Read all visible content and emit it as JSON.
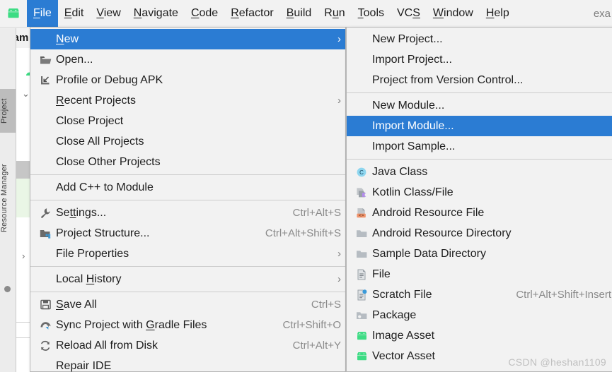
{
  "app": {
    "logo_icon": "android-logo-icon",
    "project_label_right": "exa",
    "breadcrumb_text": "exam"
  },
  "menubar": {
    "items": [
      {
        "label": "File",
        "mnemonic": "F",
        "active": true
      },
      {
        "label": "Edit",
        "mnemonic": "E",
        "active": false
      },
      {
        "label": "View",
        "mnemonic": "V",
        "active": false
      },
      {
        "label": "Navigate",
        "mnemonic": "N",
        "active": false
      },
      {
        "label": "Code",
        "mnemonic": "C",
        "active": false
      },
      {
        "label": "Refactor",
        "mnemonic": "R",
        "active": false
      },
      {
        "label": "Build",
        "mnemonic": "B",
        "active": false
      },
      {
        "label": "Run",
        "mnemonic": "u",
        "active": false
      },
      {
        "label": "Tools",
        "mnemonic": "T",
        "active": false
      },
      {
        "label": "VCS",
        "mnemonic": "S",
        "active": false
      },
      {
        "label": "Window",
        "mnemonic": "W",
        "active": false
      },
      {
        "label": "Help",
        "mnemonic": "H",
        "active": false
      }
    ]
  },
  "sidebar": {
    "tabs": [
      {
        "label": "Project",
        "selected": true
      },
      {
        "label": "Resource Manager",
        "selected": false
      }
    ]
  },
  "file_menu": {
    "items": [
      {
        "label": "New",
        "mnemonic": "N",
        "icon": "",
        "accel": "",
        "submenu": true,
        "selected": true,
        "separator_after": false
      },
      {
        "label": "Open...",
        "mnemonic": "",
        "icon": "folder-open-icon",
        "accel": "",
        "submenu": false,
        "selected": false,
        "separator_after": false
      },
      {
        "label": "Profile or Debug APK",
        "mnemonic": "",
        "icon": "apk-import-icon",
        "accel": "",
        "submenu": false,
        "selected": false,
        "separator_after": false
      },
      {
        "label": "Recent Projects",
        "mnemonic": "R",
        "icon": "",
        "accel": "",
        "submenu": true,
        "selected": false,
        "separator_after": false
      },
      {
        "label": "Close Project",
        "mnemonic": "",
        "icon": "",
        "accel": "",
        "submenu": false,
        "selected": false,
        "separator_after": false
      },
      {
        "label": "Close All Projects",
        "mnemonic": "",
        "icon": "",
        "accel": "",
        "submenu": false,
        "selected": false,
        "separator_after": false
      },
      {
        "label": "Close Other Projects",
        "mnemonic": "",
        "icon": "",
        "accel": "",
        "submenu": false,
        "selected": false,
        "separator_after": true
      },
      {
        "label": "Add C++ to Module",
        "mnemonic": "",
        "icon": "",
        "accel": "",
        "submenu": false,
        "selected": false,
        "separator_after": true
      },
      {
        "label": "Settings...",
        "mnemonic": "tt",
        "icon": "wrench-icon",
        "accel": "Ctrl+Alt+S",
        "submenu": false,
        "selected": false,
        "separator_after": false
      },
      {
        "label": "Project Structure...",
        "mnemonic": "",
        "icon": "module-icon",
        "accel": "Ctrl+Alt+Shift+S",
        "submenu": false,
        "selected": false,
        "separator_after": false
      },
      {
        "label": "File Properties",
        "mnemonic": "",
        "icon": "",
        "accel": "",
        "submenu": true,
        "selected": false,
        "separator_after": true
      },
      {
        "label": "Local History",
        "mnemonic": "H",
        "icon": "",
        "accel": "",
        "submenu": true,
        "selected": false,
        "separator_after": true
      },
      {
        "label": "Save All",
        "mnemonic": "S",
        "icon": "save-icon",
        "accel": "Ctrl+S",
        "submenu": false,
        "selected": false,
        "separator_after": false
      },
      {
        "label": "Sync Project with Gradle Files",
        "mnemonic": "G",
        "icon": "gradle-sync-icon",
        "accel": "Ctrl+Shift+O",
        "submenu": false,
        "selected": false,
        "separator_after": false
      },
      {
        "label": "Reload All from Disk",
        "mnemonic": "",
        "icon": "reload-icon",
        "accel": "Ctrl+Alt+Y",
        "submenu": false,
        "selected": false,
        "separator_after": false
      },
      {
        "label": "Repair IDE",
        "mnemonic": "",
        "icon": "",
        "accel": "",
        "submenu": false,
        "selected": false,
        "separator_after": false
      }
    ]
  },
  "new_submenu": {
    "items": [
      {
        "label": "New Project...",
        "icon": "",
        "accel": "",
        "selected": false,
        "separator_after": false
      },
      {
        "label": "Import Project...",
        "icon": "",
        "accel": "",
        "selected": false,
        "separator_after": false
      },
      {
        "label": "Project from Version Control...",
        "icon": "",
        "accel": "",
        "selected": false,
        "separator_after": true
      },
      {
        "label": "New Module...",
        "icon": "",
        "accel": "",
        "selected": false,
        "separator_after": false
      },
      {
        "label": "Import Module...",
        "icon": "",
        "accel": "",
        "selected": true,
        "separator_after": false
      },
      {
        "label": "Import Sample...",
        "icon": "",
        "accel": "",
        "selected": false,
        "separator_after": true
      },
      {
        "label": "Java Class",
        "icon": "java-class-icon",
        "accel": "",
        "selected": false,
        "separator_after": false
      },
      {
        "label": "Kotlin Class/File",
        "icon": "kotlin-class-icon",
        "accel": "",
        "selected": false,
        "separator_after": false
      },
      {
        "label": "Android Resource File",
        "icon": "android-resource-file-icon",
        "accel": "",
        "selected": false,
        "separator_after": false
      },
      {
        "label": "Android Resource Directory",
        "icon": "folder-icon",
        "accel": "",
        "selected": false,
        "separator_after": false
      },
      {
        "label": "Sample Data Directory",
        "icon": "folder-icon",
        "accel": "",
        "selected": false,
        "separator_after": false
      },
      {
        "label": "File",
        "icon": "file-icon",
        "accel": "",
        "selected": false,
        "separator_after": false
      },
      {
        "label": "Scratch File",
        "icon": "scratch-file-icon",
        "accel": "Ctrl+Alt+Shift+Insert",
        "selected": false,
        "separator_after": false
      },
      {
        "label": "Package",
        "icon": "package-icon",
        "accel": "",
        "selected": false,
        "separator_after": false
      },
      {
        "label": "Image Asset",
        "icon": "android-logo-icon",
        "accel": "",
        "selected": false,
        "separator_after": false
      },
      {
        "label": "Vector Asset",
        "icon": "android-logo-icon",
        "accel": "",
        "selected": false,
        "separator_after": false
      }
    ]
  },
  "watermark": {
    "text": "CSDN @heshan1109"
  },
  "colors": {
    "selection_blue": "#2b7cd3",
    "menu_bg": "#f2f2f2",
    "android_green": "#3ddc84",
    "accel_gray": "#8a8a8a"
  }
}
